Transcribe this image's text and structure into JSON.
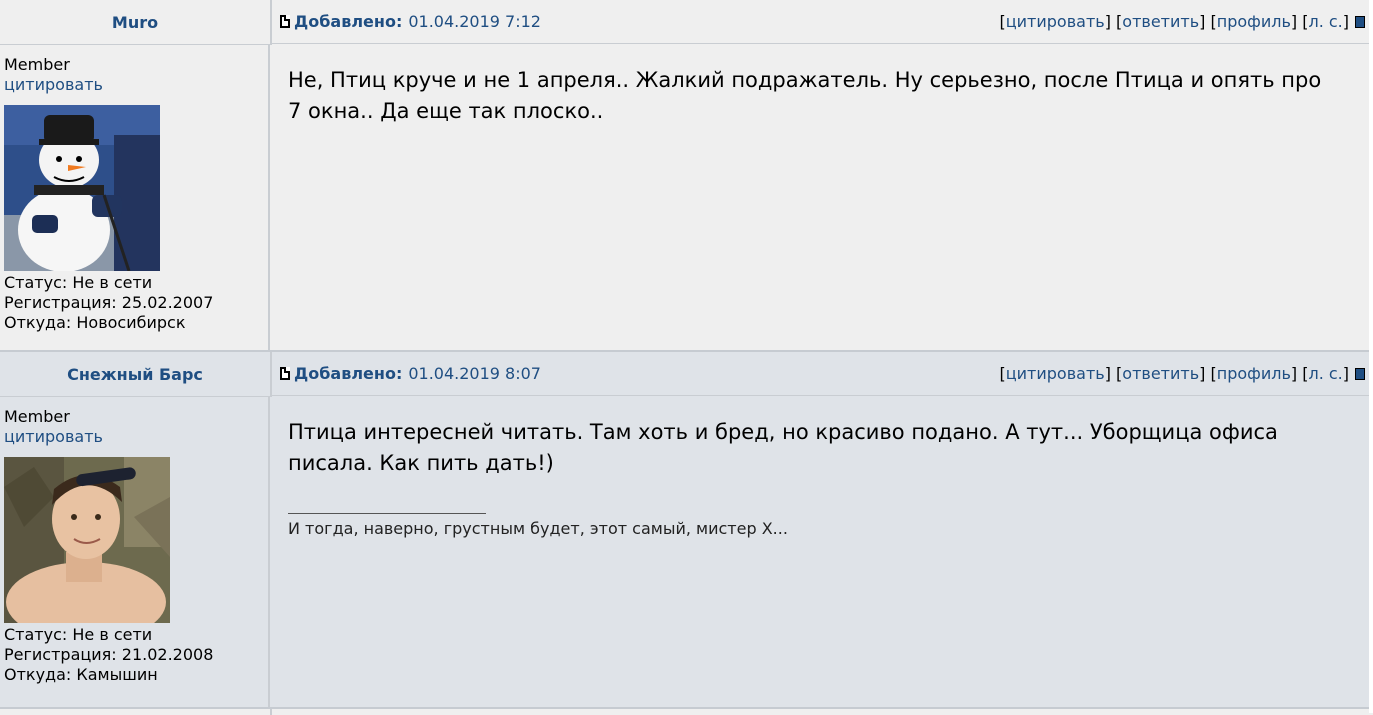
{
  "posts": [
    {
      "author": "Muro",
      "added_label": "Добавлено:",
      "date": "01.04.2019 7:12",
      "actions": {
        "quote": "цитировать",
        "reply": "ответить",
        "profile": "профиль",
        "pm": "л. с."
      },
      "rank": "Member",
      "quote_link": "цитировать",
      "status": "Статус: Не в сети",
      "registration": "Регистрация: 25.02.2007",
      "location": "Откуда: Новосибирск",
      "text_line1": "Не, Птиц круче и не 1 апреля.. Жалкий подражатель. Ну серьезно, после Птица и опять про",
      "text_line2": "7 окна.. Да еще так плоско..",
      "avatar_icon": "snowman-hockey-avatar"
    },
    {
      "author": "Снежный Барс",
      "added_label": "Добавлено:",
      "date": "01.04.2019 8:07",
      "actions": {
        "quote": "цитировать",
        "reply": "ответить",
        "profile": "профиль",
        "pm": "л. с."
      },
      "rank": "Member",
      "quote_link": "цитировать",
      "status": "Статус: Не в сети",
      "registration": "Регистрация: 21.02.2008",
      "location": "Откуда: Камышин",
      "text_line1": "Птица интересней читать. Там хоть и бред, но красиво подано. А тут... Уборщица офиса",
      "text_line2": "писала. Как пить дать!)",
      "signature": "И тогда, наверно, грустным будет, этот самый, мистер Х...",
      "avatar_icon": "person-photo-avatar"
    }
  ],
  "colors": {
    "link": "#1f4e82",
    "post1_bg": "#efefef",
    "post2_bg": "#dfe3e8",
    "border": "#c9cdd2"
  }
}
